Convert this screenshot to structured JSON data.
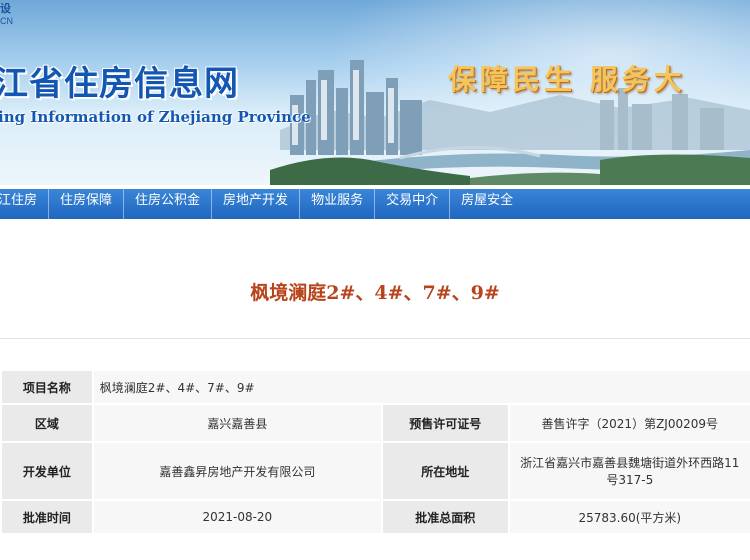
{
  "banner": {
    "logo_top": "设",
    "logo_domain": "CN",
    "title": "江省住房信息网",
    "subtitle": "ing Information of Zhejiang Province",
    "slogan": "保障民生 服务大"
  },
  "nav": {
    "items": [
      "江住房",
      "住房保障",
      "住房公积金",
      "房地产开发",
      "物业服务",
      "交易中介",
      "房屋安全"
    ]
  },
  "page": {
    "title": "枫境澜庭2#、4#、7#、9#"
  },
  "info": {
    "project_name_label": "项目名称",
    "project_name": "枫境澜庭2#、4#、7#、9#",
    "region_label": "区域",
    "region": "嘉兴嘉善县",
    "permit_label": "预售许可证号",
    "permit": "善售许字（2021）第ZJ00209号",
    "developer_label": "开发单位",
    "developer": "嘉善鑫昇房地产开发有限公司",
    "address_label": "所在地址",
    "address": "浙江省嘉兴市嘉善县魏塘街道外环西路11号317-5",
    "approval_time_label": "批准时间",
    "approval_time": "2021-08-20",
    "approval_area_label": "批准总面积",
    "approval_area": "25783.60(平方米)"
  },
  "colors": {
    "nav_bg": "#2a74cc",
    "title_color": "#b8441c",
    "slogan_color": "#f4c55a",
    "label_bg": "#eaeaea",
    "value_bg": "#f7f7f7"
  }
}
